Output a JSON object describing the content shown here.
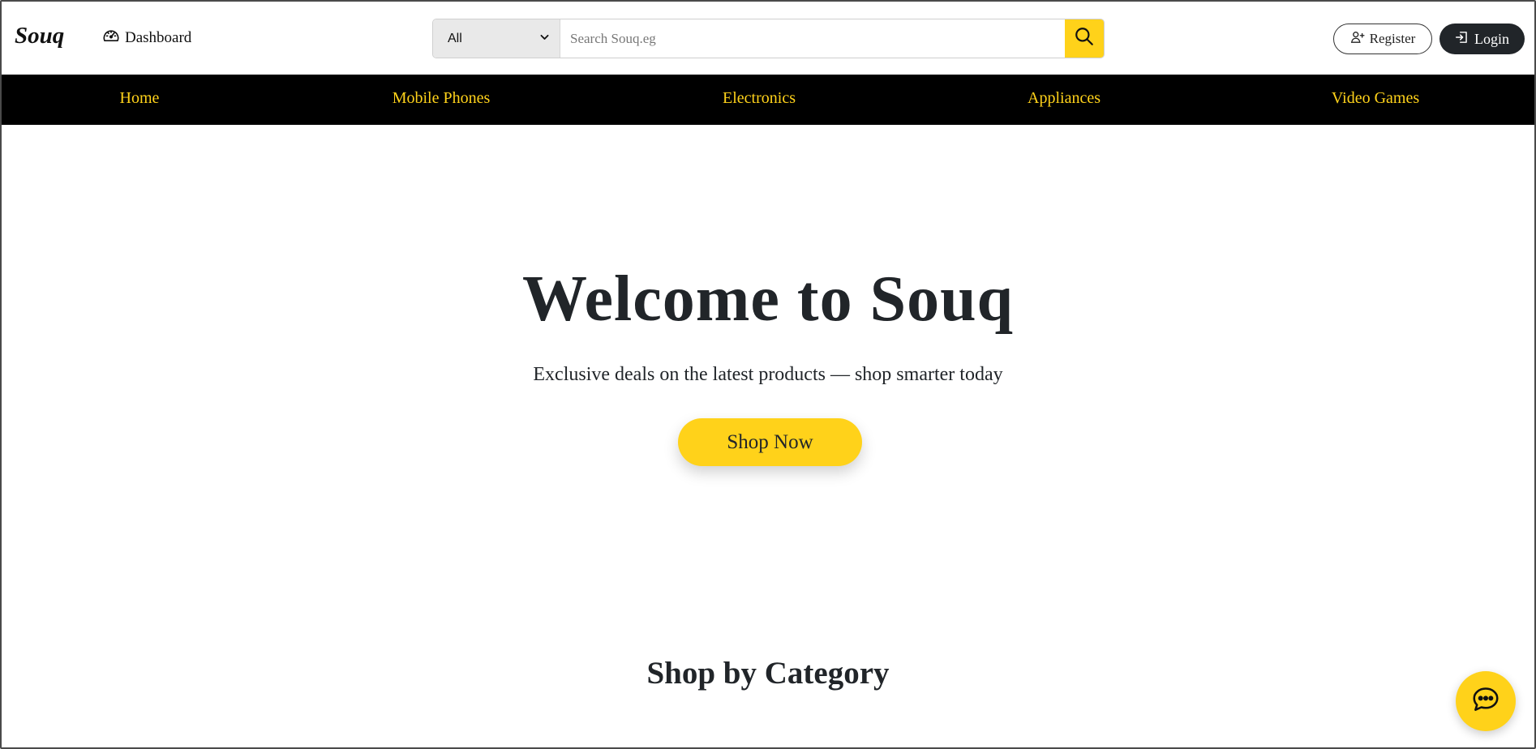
{
  "header": {
    "brand": "Souq",
    "dashboard_label": "Dashboard",
    "search": {
      "category_selected": "All",
      "placeholder": "Search Souq.eg"
    },
    "register_label": "Register",
    "login_label": "Login"
  },
  "nav": {
    "items": [
      {
        "label": "Home"
      },
      {
        "label": "Mobile Phones"
      },
      {
        "label": "Electronics"
      },
      {
        "label": "Appliances"
      },
      {
        "label": "Video Games"
      }
    ]
  },
  "hero": {
    "title": "Welcome to Souq",
    "subtitle": "Exclusive deals on the latest products — shop smarter today",
    "cta_label": "Shop Now"
  },
  "categories": {
    "title": "Shop by Category"
  },
  "icons": {
    "dashboard": "speedometer-icon",
    "dropdown": "chevron-down-icon",
    "search": "search-icon",
    "register": "person-plus-icon",
    "login": "login-icon",
    "chat": "chat-icon"
  },
  "colors": {
    "accent": "#ffd21a",
    "nav_background": "#000000",
    "dark_button": "#212529"
  }
}
